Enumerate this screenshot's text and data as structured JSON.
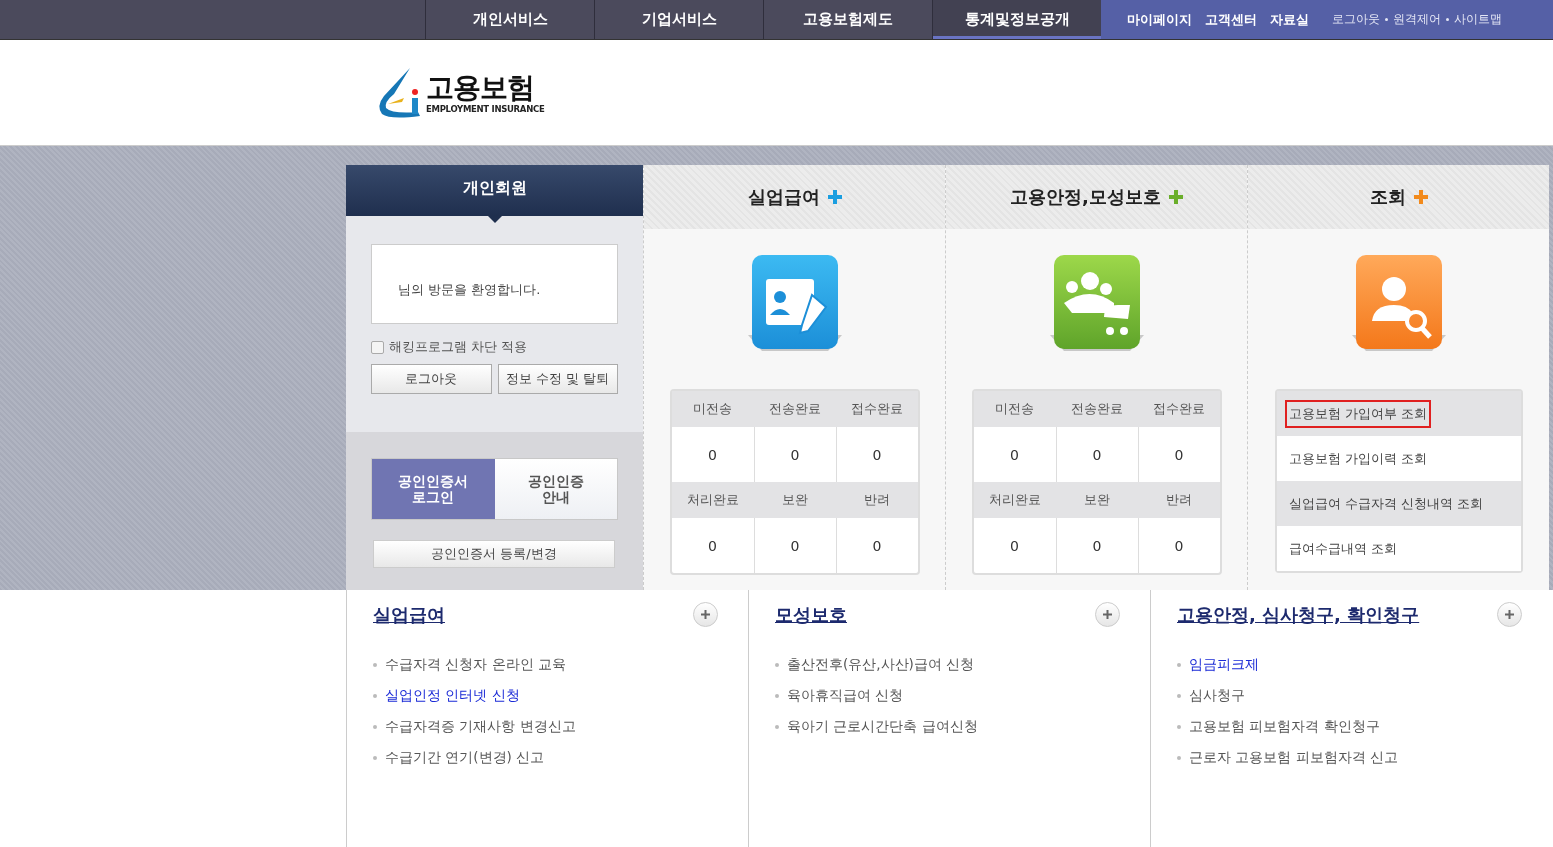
{
  "top_nav": {
    "items": [
      {
        "label": "개인서비스",
        "selected": false
      },
      {
        "label": "기업서비스",
        "selected": false
      },
      {
        "label": "고용보험제도",
        "selected": false
      },
      {
        "label": "통계및정보공개",
        "selected": true
      }
    ],
    "main_links": [
      "마이페이지",
      "고객센터",
      "자료실"
    ],
    "sub_links": [
      "로그아웃",
      "원격제어",
      "사이트맵"
    ]
  },
  "logo": {
    "title": "고용보험",
    "subtitle": "EMPLOYMENT INSURANCE"
  },
  "member_panel": {
    "tab": "개인회원",
    "welcome": "님의 방문을 환영합니다.",
    "checkbox": {
      "label": "해킹프로그램 차단 적용",
      "checked": false
    },
    "buttons": [
      "로그아웃",
      "정보 수정 및 탈퇴"
    ],
    "cert_tabs": [
      {
        "label": "공인인증서\n로그인",
        "selected": true
      },
      {
        "label": "공인인증\n안내",
        "selected": false
      }
    ],
    "cert_button": "공인인증서 등록/변경"
  },
  "service_columns": [
    {
      "title": "실업급여",
      "color": "#1a9ee0",
      "kind": "stats",
      "rows": [
        {
          "headers": [
            "미전송",
            "전송완료",
            "접수완료"
          ],
          "values": [
            "0",
            "0",
            "0"
          ]
        },
        {
          "headers": [
            "처리완료",
            "보완",
            "반려"
          ],
          "values": [
            "0",
            "0",
            "0"
          ]
        }
      ]
    },
    {
      "title": "고용안정,모성보호",
      "color": "#6aae2a",
      "kind": "stats",
      "rows": [
        {
          "headers": [
            "미전송",
            "전송완료",
            "접수완료"
          ],
          "values": [
            "0",
            "0",
            "0"
          ]
        },
        {
          "headers": [
            "처리완료",
            "보완",
            "반려"
          ],
          "values": [
            "0",
            "0",
            "0"
          ]
        }
      ]
    },
    {
      "title": "조회",
      "color": "#f28a1c",
      "kind": "links",
      "links": [
        {
          "label": "고용보험 가입여부 조회",
          "highlighted": true
        },
        {
          "label": "고용보험 가입이력 조회",
          "highlighted": false
        },
        {
          "label": "실업급여 수급자격 신청내역 조회",
          "highlighted": false
        },
        {
          "label": "급여수급내역 조회",
          "highlighted": false
        }
      ]
    }
  ],
  "bottom_sections": [
    {
      "title": "실업급여",
      "links": [
        {
          "label": "수급자격 신청자 온라인 교육",
          "emphasized": false
        },
        {
          "label": "실업인정 인터넷 신청",
          "emphasized": true
        },
        {
          "label": "수급자격증 기재사항 변경신고",
          "emphasized": false
        },
        {
          "label": "수급기간 연기(변경) 신고",
          "emphasized": false
        }
      ]
    },
    {
      "title": "모성보호",
      "links": [
        {
          "label": "출산전후(유산,사산)급여 신청",
          "emphasized": false
        },
        {
          "label": "육아휴직급여 신청",
          "emphasized": false
        },
        {
          "label": "육아기 근로시간단축 급여신청",
          "emphasized": false
        }
      ]
    },
    {
      "title": "고용안정, 심사청구, 확인청구",
      "links": [
        {
          "label": "임금피크제",
          "emphasized": true
        },
        {
          "label": "심사청구",
          "emphasized": false
        },
        {
          "label": "고용보험 피보험자격 확인청구",
          "emphasized": false
        },
        {
          "label": "근로자 고용보험 피보험자격 신고",
          "emphasized": false
        }
      ]
    }
  ]
}
